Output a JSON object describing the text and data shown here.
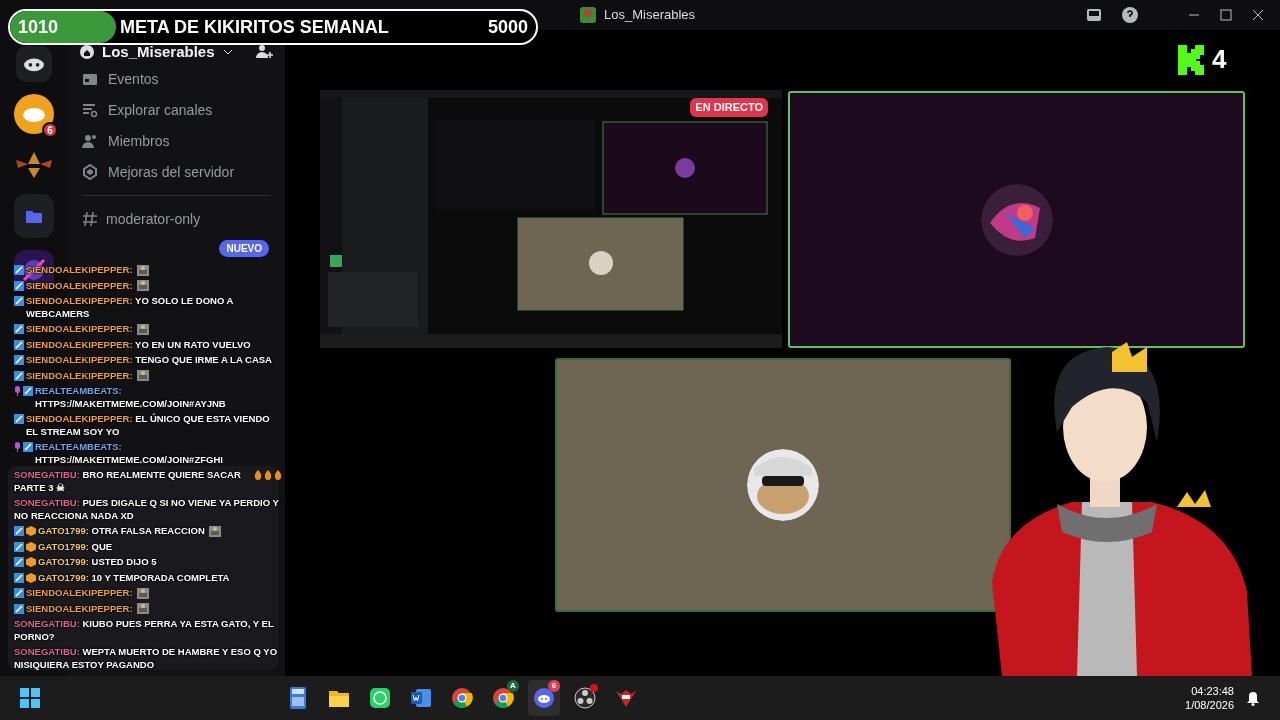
{
  "goal": {
    "current": "1010",
    "title": "META DE KIKIRITOS SEMANAL",
    "target": "5000",
    "level": 0.202
  },
  "window": {
    "title": "Los_Miserables"
  },
  "server_rail": {
    "badge": "6"
  },
  "sidebar": {
    "server_name": "Los_Miserables",
    "items": [
      {
        "label": "Eventos",
        "kind": "events"
      },
      {
        "label": "Explorar canales",
        "kind": "browse"
      },
      {
        "label": "Miembros",
        "kind": "members"
      },
      {
        "label": "Mejoras del servidor",
        "kind": "boost"
      }
    ],
    "channels": [
      {
        "name": "moderator-only"
      }
    ],
    "new_badge": "NUEVO"
  },
  "stage": {
    "tiles": [
      {
        "kind": "screen",
        "live_badge": "EN DIRECTO"
      },
      {
        "kind": "avatar",
        "color": "#1e0a1f",
        "highlighted": true
      },
      {
        "kind": "avatar",
        "color": "#6e6552",
        "highlighted": false
      }
    ]
  },
  "viewer_counter": {
    "count": "4"
  },
  "chat": [
    {
      "user": "SIENDOALEKIPEPPER:",
      "color": "#f0a12e",
      "badges": [
        {
          "kind": "sword"
        }
      ],
      "emote": true
    },
    {
      "user": "SIENDOALEKIPEPPER:",
      "color": "#f0a12e",
      "badges": [
        {
          "kind": "sword"
        }
      ],
      "emote": true
    },
    {
      "user": "SIENDOALEKIPEPPER:",
      "color": "#f0a12e",
      "badges": [
        {
          "kind": "sword"
        }
      ],
      "text": "YO SOLO LE DONO A WEBCAMERS"
    },
    {
      "user": "SIENDOALEKIPEPPER:",
      "color": "#f0a12e",
      "badges": [
        {
          "kind": "sword"
        }
      ],
      "emote": true
    },
    {
      "user": "SIENDOALEKIPEPPER:",
      "color": "#f0a12e",
      "badges": [
        {
          "kind": "sword"
        }
      ],
      "text": "YO EN UN RATO VUELVO"
    },
    {
      "user": "SIENDOALEKIPEPPER:",
      "color": "#f0a12e",
      "badges": [
        {
          "kind": "sword"
        }
      ],
      "text": "TENGO QUE IRME A LA CASA"
    },
    {
      "user": "SIENDOALEKIPEPPER:",
      "color": "#f0a12e",
      "badges": [
        {
          "kind": "sword"
        }
      ],
      "emote": true
    },
    {
      "user": "REALTEAMBEATS:",
      "color": "#6fa6ee",
      "badges": [
        {
          "kind": "mic"
        },
        {
          "kind": "sword"
        }
      ],
      "text": "HTTPS://MAKEITMEME.COM/JOIN#AYJNB"
    },
    {
      "user": "SIENDOALEKIPEPPER:",
      "color": "#f0a12e",
      "badges": [
        {
          "kind": "sword"
        }
      ],
      "text": "EL ÚNICO QUE ESTA VIENDO EL STREAM SOY YO"
    },
    {
      "user": "REALTEAMBEATS:",
      "color": "#6fa6ee",
      "badges": [
        {
          "kind": "mic"
        },
        {
          "kind": "sword"
        }
      ],
      "text": "HTTPS://MAKEITMEME.COM/JOIN#ZFGHI"
    },
    {
      "user": "SONEGATIBU:",
      "color": "#e2628c",
      "text": "BRO REALMENTE QUIERE SACAR PARTE 3 ☠",
      "icons": [
        {
          "kind": "fire"
        },
        {
          "kind": "fire"
        },
        {
          "kind": "fire"
        }
      ]
    },
    {
      "user": "SONEGATIBU:",
      "color": "#e2628c",
      "text": "PUES DIGALE Q SI NO VIENE YA PERDIO Y NO REACCIONA NADA XD"
    },
    {
      "user": "GATO1799:",
      "color": "#f2c46a",
      "badges": [
        {
          "kind": "sword"
        },
        {
          "kind": "box"
        }
      ],
      "text": "OTRA FALSA REACCION",
      "emote": true
    },
    {
      "user": "GATO1799:",
      "color": "#f2c46a",
      "badges": [
        {
          "kind": "sword"
        },
        {
          "kind": "box"
        }
      ],
      "text": "QUE"
    },
    {
      "user": "GATO1799:",
      "color": "#f2c46a",
      "badges": [
        {
          "kind": "sword"
        },
        {
          "kind": "box"
        }
      ],
      "text": "USTED DIJO 5"
    },
    {
      "user": "GATO1799:",
      "color": "#f2c46a",
      "badges": [
        {
          "kind": "sword"
        },
        {
          "kind": "box"
        }
      ],
      "text": "10 Y TEMPORADA COMPLETA"
    },
    {
      "user": "SIENDOALEKIPEPPER:",
      "color": "#f0a12e",
      "badges": [
        {
          "kind": "sword"
        }
      ],
      "emote": true
    },
    {
      "user": "SIENDOALEKIPEPPER:",
      "color": "#f0a12e",
      "badges": [
        {
          "kind": "sword"
        }
      ],
      "emote": true
    },
    {
      "user": "SONEGATIBU:",
      "color": "#e2628c",
      "text": "KIUBO PUES PERRA YA ESTA GATO, Y EL PORNO?"
    },
    {
      "user": "SONEGATIBU:",
      "color": "#e2628c",
      "text": "WEPTA MUERTO DE HAMBRE Y ESO Q YO NISIQUIERA ESTOY PAGANDO"
    }
  ],
  "taskbar": {
    "apps": [
      {
        "kind": "calculator"
      },
      {
        "kind": "files"
      },
      {
        "kind": "whatsapp"
      },
      {
        "kind": "word"
      },
      {
        "kind": "chrome"
      },
      {
        "kind": "chrome",
        "badge": "A"
      },
      {
        "kind": "discord",
        "badge": "6",
        "active": true
      },
      {
        "kind": "obs",
        "alert": true
      },
      {
        "kind": "game"
      }
    ],
    "time": "04:23:48",
    "date": "1/08/2026"
  }
}
